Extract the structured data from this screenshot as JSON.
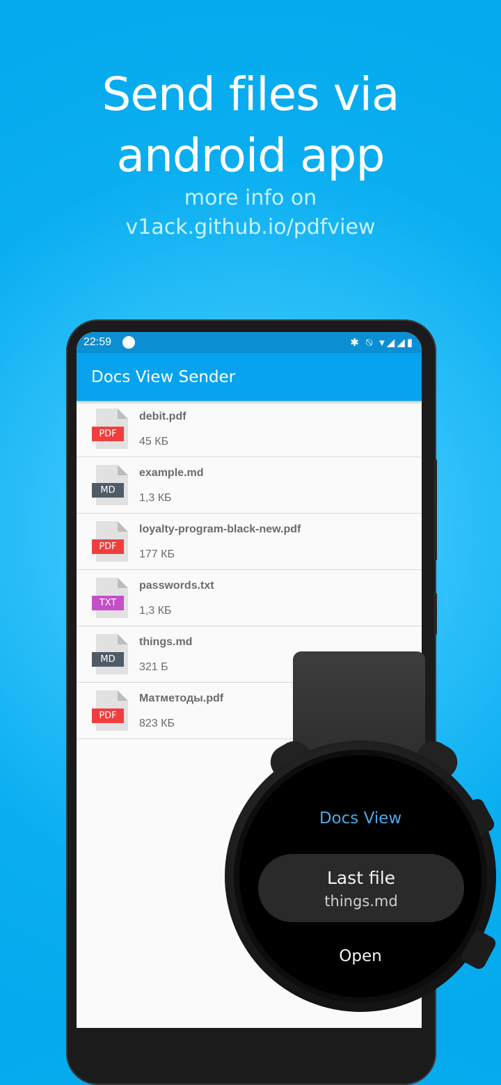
{
  "promo": {
    "headline_line1": "Send files via",
    "headline_line2": "android app",
    "sub_line1": "more info on",
    "sub_line2": "v1ack.github.io/pdfview"
  },
  "phone": {
    "status": {
      "time": "22:59",
      "icons": "✱ ⍉ ▾◢◢▮"
    },
    "appbar": {
      "title": "Docs View Sender"
    },
    "files": [
      {
        "name": "debit.pdf",
        "size": "45 КБ",
        "type": "PDF",
        "color": "#f03e3e"
      },
      {
        "name": "example.md",
        "size": "1,3 КБ",
        "type": "MD",
        "color": "#4f5b66"
      },
      {
        "name": "loyalty-program-black-new.pdf",
        "size": "177 КБ",
        "type": "PDF",
        "color": "#f03e3e"
      },
      {
        "name": "passwords.txt",
        "size": "1,3 КБ",
        "type": "TXT",
        "color": "#c44fc8"
      },
      {
        "name": "things.md",
        "size": "321 Б",
        "type": "MD",
        "color": "#4f5b66"
      },
      {
        "name": "Матметоды.pdf",
        "size": "823 КБ",
        "type": "PDF",
        "color": "#f03e3e"
      }
    ]
  },
  "watch": {
    "title": "Docs View",
    "last_file_label": "Last file",
    "last_file_name": "things.md",
    "open_label": "Open"
  }
}
